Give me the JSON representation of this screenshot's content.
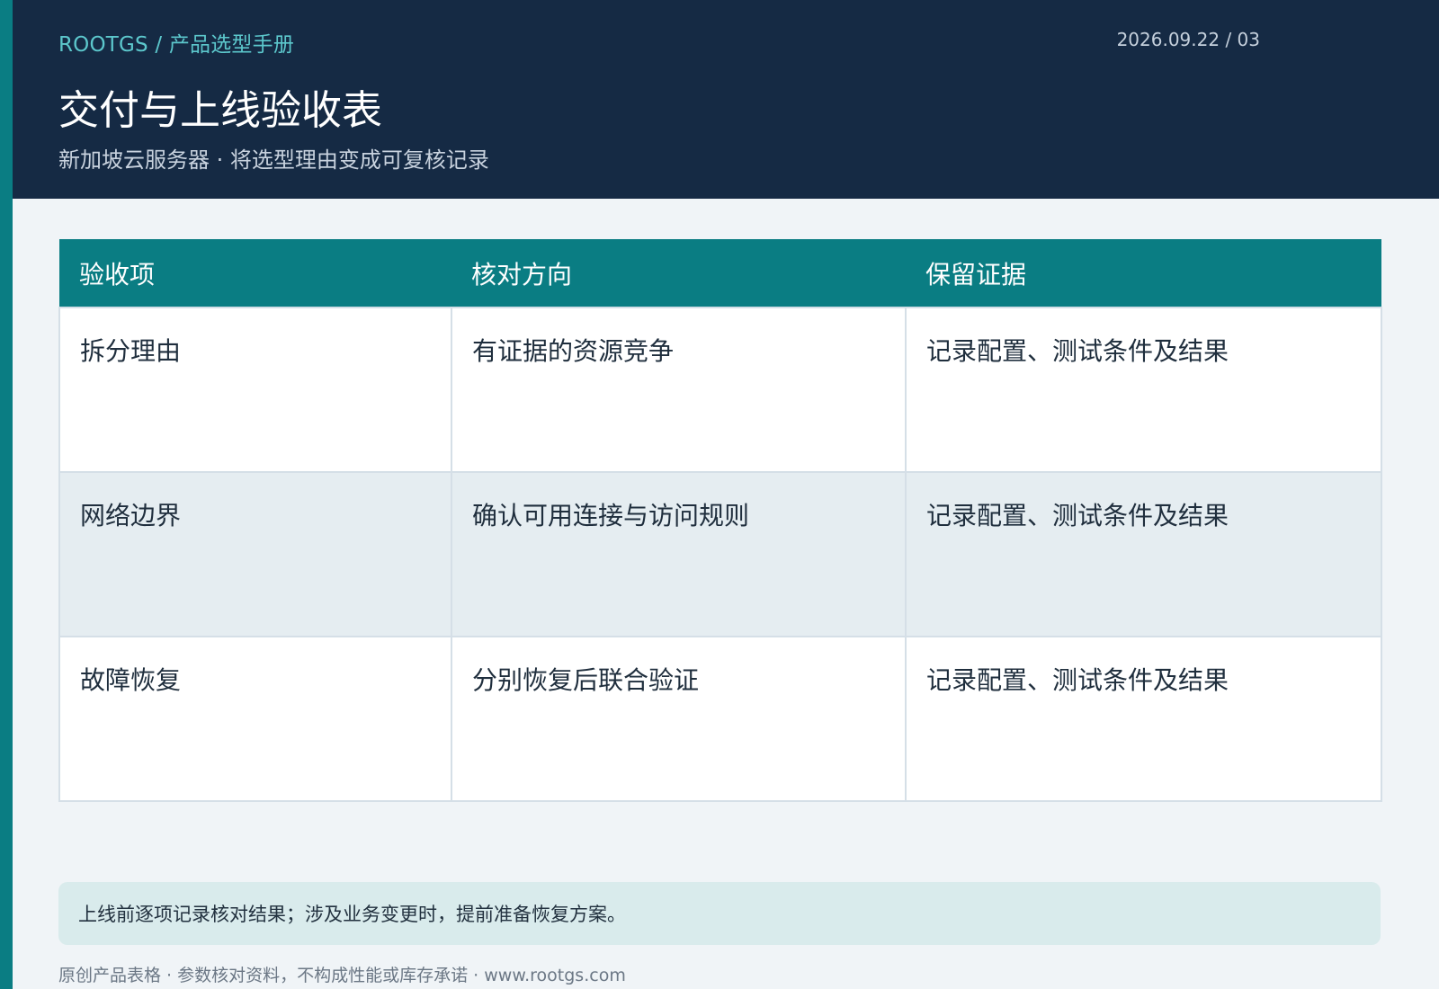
{
  "header": {
    "breadcrumb": "ROOTGS / 产品选型手册",
    "date": "2026.09.22 / 03",
    "title": "交付与上线验收表",
    "subtitle": "新加坡云服务器 · 将选型理由变成可复核记录"
  },
  "table": {
    "columns": [
      "验收项",
      "核对方向",
      "保留证据"
    ],
    "rows": [
      [
        "拆分理由",
        "有证据的资源竞争",
        "记录配置、测试条件及结果"
      ],
      [
        "网络边界",
        "确认可用连接与访问规则",
        "记录配置、测试条件及结果"
      ],
      [
        "故障恢复",
        "分别恢复后联合验证",
        "记录配置、测试条件及结果"
      ]
    ]
  },
  "note": "上线前逐项记录核对结果；涉及业务变更时，提前准备恢复方案。",
  "footer": "原创产品表格 · 参数核对资料，不构成性能或库存承诺 · www.rootgs.com",
  "colors": {
    "header_bg": "#152a44",
    "accent": "#0a7d83",
    "breadcrumb": "#5cc7cc",
    "note_bg": "#d9ebec",
    "page_bg": "#f0f4f7"
  }
}
